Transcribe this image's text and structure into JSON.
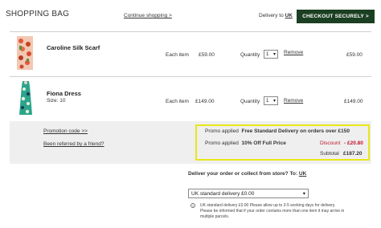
{
  "header": {
    "title": "SHOPPING BAG",
    "continue_link": "Continue shopping >",
    "delivery_to_label": "Delivery to",
    "delivery_country": "UK",
    "checkout_button": "CHECKOUT SECURELY >"
  },
  "items": [
    {
      "name": "Caroline Silk Scarf",
      "size": "",
      "each_label": "Each item",
      "each_price": "£59.00",
      "qty_label": "Quantity",
      "qty_value": "1",
      "remove_label": "Remove",
      "total": "£59.00"
    },
    {
      "name": "Fiona Dress",
      "size": "Size: 10",
      "each_label": "Each item",
      "each_price": "£149.00",
      "qty_label": "Quantity",
      "qty_value": "1",
      "remove_label": "Remove",
      "total": "£149.00"
    }
  ],
  "summary": {
    "promotion_code_link": "Promotion code >>",
    "referred_link": "Been referred by a friend?",
    "promo1_label": "Promo applied",
    "promo1_text": "Free Standard Delivery on orders over £150",
    "promo2_label": "Promo applied",
    "promo2_text": "10% Off Full Price",
    "discount_label": "Discount",
    "discount_value": "- £20.80",
    "subtotal_label": "Subtotal",
    "subtotal_value": "£187.20"
  },
  "delivery": {
    "question": "Deliver your order or collect from store?",
    "to_label": "To:",
    "country": "UK",
    "selected_option": "UK standard delivery £0.00",
    "note": "UK standard delivery £0.00 Please allow up to 3-5 working days for delivery. Please be informed that if your order contains more than one item it may arrive in multiple parcels."
  },
  "colors": {
    "checkout_bg": "#1b3f22",
    "highlight_border": "#e6e61a",
    "discount_red": "#c0162c"
  }
}
